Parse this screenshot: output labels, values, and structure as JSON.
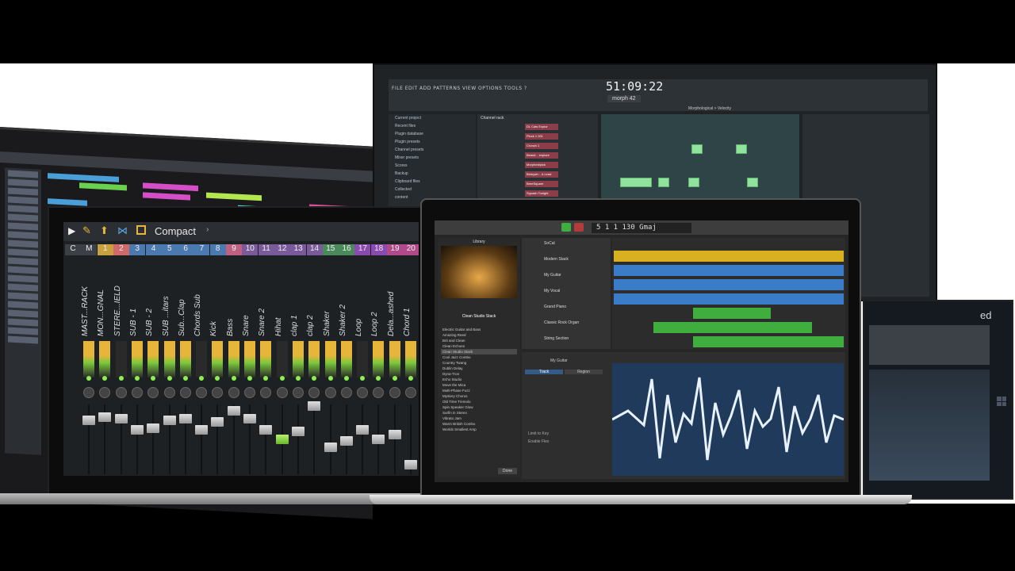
{
  "fl_studio": {
    "menu": "FILE  EDIT  ADD  PATTERNS  VIEW  OPTIONS  TOOLS  ?",
    "time": "51:09:22",
    "pattern": "morph 42",
    "browser": [
      "Current project",
      "Recent files",
      "Plugin database",
      "Plugin presets",
      "Channel presets",
      "Mixer presets",
      "Scores",
      "Backup",
      "Clipboard files",
      "Collected",
      "content"
    ],
    "rack_title": "Channel rack",
    "channels": [
      "DL Cats Explor",
      "Pluck 1 001",
      "Crunch 1",
      "Beauti... explore",
      "Morphed/pick",
      "Betoyah... A Lead",
      "BreeSquare",
      "Squash Tonight",
      "The Talkback"
    ],
    "piano_roll_label": "Morphological > Velocity"
  },
  "mixer": {
    "title": "Compact",
    "numbers": [
      "C",
      "M",
      "1",
      "2",
      "3",
      "4",
      "5",
      "6",
      "7",
      "8",
      "9",
      "10",
      "11",
      "12",
      "13",
      "14",
      "15",
      "16",
      "17",
      "18",
      "19",
      "20"
    ],
    "tracks": [
      "MAST...RACK",
      "MON...GNAL",
      "STERE...IELD",
      "SUB - 1",
      "SUB - 2",
      "SUB ...itars",
      "Sub...Clap",
      "Chords Sub",
      "Kick",
      "Bass",
      "Snare",
      "Snare 2",
      "Hihat",
      "clap 1",
      "clap 2",
      "Shaker",
      "Shaker 2",
      "Loop",
      "Loop 2",
      "Dela...ashed",
      "Chord 1"
    ]
  },
  "garageband": {
    "lcd": "5 1  1   130  Gmaj",
    "library_title": "Library",
    "library_caption": "Clean Studio Stack",
    "library_items": [
      "Electric Guitar and Bass",
      "Amazing Reed",
      "Brit and Clean",
      "Clean Echoes",
      "Clean Studio Stack",
      "Cool Jazz Combo",
      "Country Twang",
      "Dublin Delay",
      "Dyna-Tron",
      "Echo Studio",
      "Move the Mica",
      "Multi-Phase Fuzz",
      "Mystery Chorus",
      "Old Time Tremolo",
      "Spin Speaker Glow",
      "Surfin in Stereo",
      "Vibrato Jam",
      "Warm British Combo",
      "Worlds Smallest Amp"
    ],
    "selected_item": "Clean Studio Stack",
    "tracks": [
      "SoCal",
      "Modern Stack",
      "My Guitar",
      "My Vocal",
      "Grand Piano",
      "Classic Rock Organ",
      "String Section"
    ],
    "editor_tabs": [
      "Track",
      "Region"
    ],
    "editor_region": "My Guitar",
    "editor_options": [
      "Limit to Key",
      "Enable Flex"
    ],
    "done_label": "Done"
  },
  "tablet": {
    "label": "ed"
  },
  "colors": {
    "mixer_accent": "#e6b53a",
    "fl_note": "#8fe39c",
    "gb_blue": "#3a7cc8",
    "gb_green": "#3fae3f",
    "gb_yellow": "#d8b020"
  }
}
